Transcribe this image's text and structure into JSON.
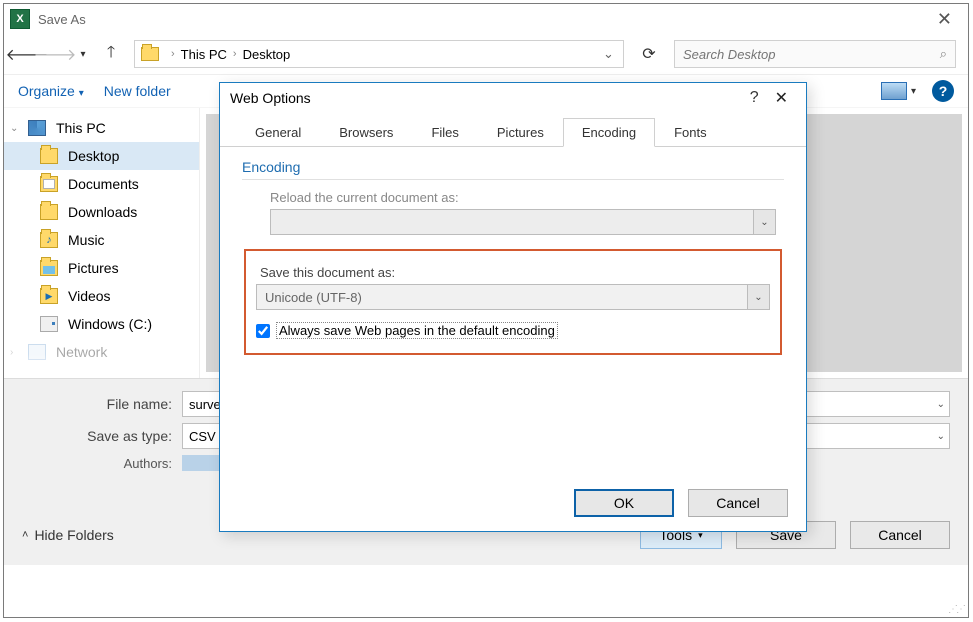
{
  "saveas": {
    "title": "Save As",
    "breadcrumb": {
      "root": "This PC",
      "leaf": "Desktop"
    },
    "search_placeholder": "Search Desktop",
    "organize": "Organize",
    "new_folder": "New folder",
    "sidebar": [
      {
        "label": "This PC",
        "icon": "pc",
        "level": 0,
        "selected": false
      },
      {
        "label": "Desktop",
        "icon": "folder",
        "level": 1,
        "selected": true
      },
      {
        "label": "Documents",
        "icon": "docs",
        "level": 1,
        "selected": false
      },
      {
        "label": "Downloads",
        "icon": "folder",
        "level": 1,
        "selected": false
      },
      {
        "label": "Music",
        "icon": "music",
        "level": 1,
        "selected": false
      },
      {
        "label": "Pictures",
        "icon": "pic",
        "level": 1,
        "selected": false
      },
      {
        "label": "Videos",
        "icon": "vid",
        "level": 1,
        "selected": false
      },
      {
        "label": "Windows (C:)",
        "icon": "drive",
        "level": 1,
        "selected": false
      },
      {
        "label": "Network",
        "icon": "net",
        "level": 0,
        "selected": false,
        "faded": true
      }
    ],
    "file_name_label": "File name:",
    "file_name_value": "surve",
    "save_type_label": "Save as type:",
    "save_type_value": "CSV (",
    "authors_label": "Authors:",
    "hide_folders": "Hide Folders",
    "tools": "Tools",
    "save": "Save",
    "cancel": "Cancel"
  },
  "webopts": {
    "title": "Web Options",
    "tabs": [
      "General",
      "Browsers",
      "Files",
      "Pictures",
      "Encoding",
      "Fonts"
    ],
    "active_tab": "Encoding",
    "section": "Encoding",
    "reload_label": "Reload the current document as:",
    "reload_value": "",
    "saveas_label": "Save this document as:",
    "saveas_value": "Unicode (UTF-8)",
    "checkbox_label": "Always save Web pages in the default encoding",
    "checkbox_checked": true,
    "ok": "OK",
    "cancel": "Cancel"
  }
}
